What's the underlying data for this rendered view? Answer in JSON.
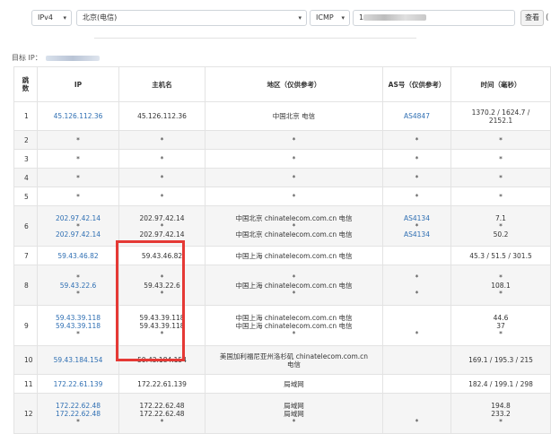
{
  "toolbar": {
    "ip_version": "IPv4",
    "location": "北京(电信)",
    "protocol": "ICMP",
    "target_value": "1",
    "submit_label": "查看",
    "edge_char": "(",
    "caret": "▾"
  },
  "target_label": "目标 IP：",
  "table": {
    "headers": [
      "跳数",
      "IP",
      "主机名",
      "地区（仅供参考）",
      "AS号（仅供参考）",
      "时间（毫秒）"
    ],
    "rows": [
      {
        "hop": "1",
        "ip": [
          "45.126.112.36"
        ],
        "host": [
          "45.126.112.36"
        ],
        "region": [
          "中国北京 电信"
        ],
        "as": [
          "AS4847"
        ],
        "time": [
          "1370.2 / 1624.7 /",
          "2152.1"
        ],
        "h": 32
      },
      {
        "hop": "2",
        "ip": [
          "*"
        ],
        "host": [
          "*"
        ],
        "region": [
          "*"
        ],
        "as": [
          "*"
        ],
        "time": [
          "*"
        ],
        "h": 21
      },
      {
        "hop": "3",
        "ip": [
          "*"
        ],
        "host": [
          "*"
        ],
        "region": [
          "*"
        ],
        "as": [
          "*"
        ],
        "time": [
          "*"
        ],
        "h": 21
      },
      {
        "hop": "4",
        "ip": [
          "*"
        ],
        "host": [
          "*"
        ],
        "region": [
          "*"
        ],
        "as": [
          "*"
        ],
        "time": [
          "*"
        ],
        "h": 21
      },
      {
        "hop": "5",
        "ip": [
          "*"
        ],
        "host": [
          "*"
        ],
        "region": [
          "*"
        ],
        "as": [
          "*"
        ],
        "time": [
          "*"
        ],
        "h": 21
      },
      {
        "hop": "6",
        "ip": [
          "202.97.42.14",
          "*",
          "202.97.42.14"
        ],
        "host": [
          "202.97.42.14",
          "*",
          "202.97.42.14"
        ],
        "region": [
          "中国北京 chinatelecom.com.cn 电信",
          "*",
          "中国北京 chinatelecom.com.cn 电信"
        ],
        "as": [
          "AS4134",
          "*",
          "AS4134"
        ],
        "time": [
          "7.1",
          "*",
          "50.2"
        ],
        "h": 45
      },
      {
        "hop": "7",
        "ip": [
          "59.43.46.82"
        ],
        "host": [
          "59.43.46.82"
        ],
        "region": [
          "中国上海 chinatelecom.com.cn 电信"
        ],
        "as": [
          ""
        ],
        "time": [
          "45.3 / 51.5 / 301.5"
        ],
        "h": 21
      },
      {
        "hop": "8",
        "ip": [
          "*",
          "59.43.22.6",
          "*"
        ],
        "host": [
          "*",
          "59.43.22.6",
          "*"
        ],
        "region": [
          "*",
          "中国上海 chinatelecom.com.cn 电信",
          "*"
        ],
        "as": [
          "*",
          "",
          "*"
        ],
        "time": [
          "*",
          "108.1",
          "*"
        ],
        "h": 45
      },
      {
        "hop": "9",
        "ip": [
          "59.43.39.118",
          "59.43.39.118",
          "*"
        ],
        "host": [
          "59.43.39.118",
          "59.43.39.118",
          "*"
        ],
        "region": [
          "中国上海 chinatelecom.com.cn 电信",
          "中国上海 chinatelecom.com.cn 电信",
          "*"
        ],
        "as": [
          "",
          "",
          "*"
        ],
        "time": [
          "44.6",
          "37",
          "*"
        ],
        "h": 45
      },
      {
        "hop": "10",
        "ip": [
          "59.43.184.154"
        ],
        "host": [
          "59.43.184.154"
        ],
        "region": [
          "美国加利福尼亚州洛杉矶 chinatelecom.com.cn",
          "电信"
        ],
        "as": [
          ""
        ],
        "time": [
          "169.1 / 195.3 / 215"
        ],
        "h": 32
      },
      {
        "hop": "11",
        "ip": [
          "172.22.61.139"
        ],
        "host": [
          "172.22.61.139"
        ],
        "region": [
          "局域网"
        ],
        "as": [
          ""
        ],
        "time": [
          "182.4 / 199.1 / 298"
        ],
        "h": 21
      },
      {
        "hop": "12",
        "ip": [
          "172.22.62.48",
          "172.22.62.48",
          "*"
        ],
        "host": [
          "172.22.62.48",
          "172.22.62.48",
          "*"
        ],
        "region": [
          "局域网",
          "局域网",
          "*"
        ],
        "as": [
          "",
          "",
          "*"
        ],
        "time": [
          "194.8",
          "233.2",
          "*"
        ],
        "h": 45
      }
    ]
  },
  "colors": {
    "link": "#2f6fb3",
    "highlight_box": "#e53935"
  }
}
